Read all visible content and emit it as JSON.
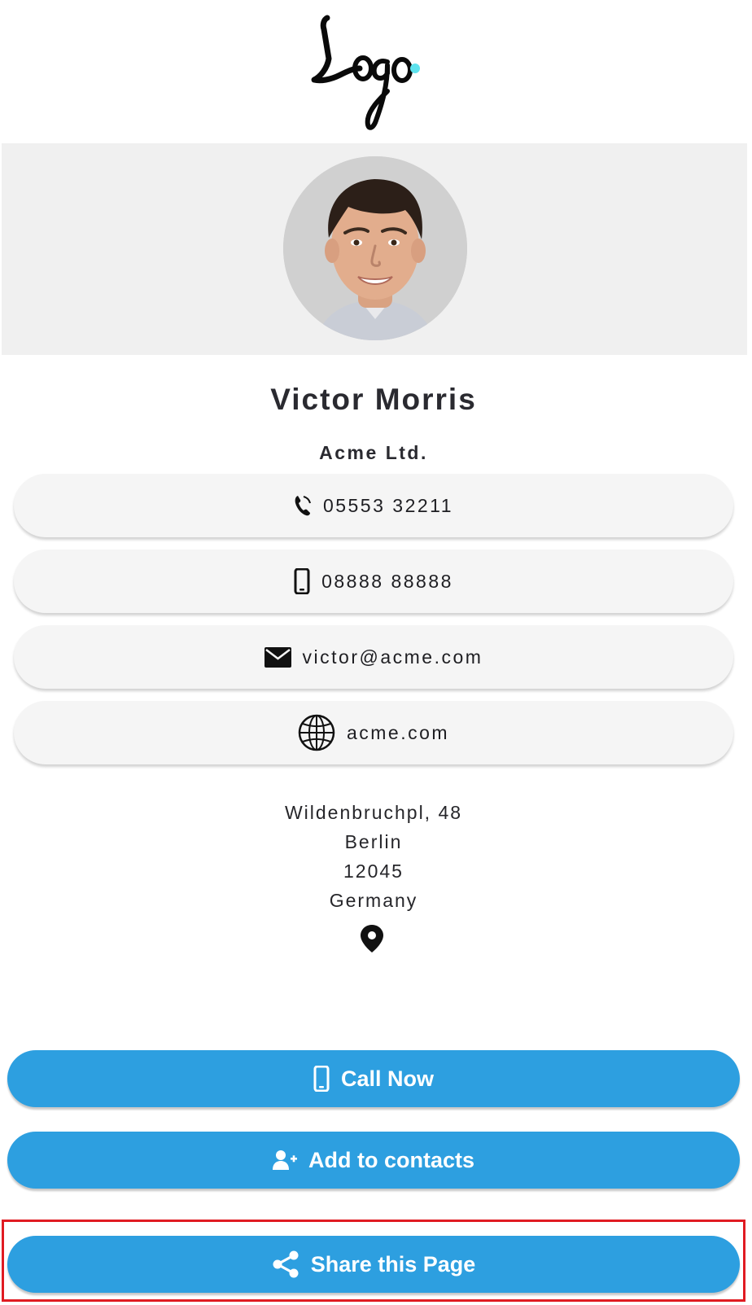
{
  "header": {
    "logo_text": "Logo",
    "logo_accent": "#5ee3ee",
    "logo_icon": "logo-wordmark"
  },
  "profile": {
    "name": "Victor Morris",
    "company": "Acme Ltd.",
    "avatar_icon": "profile-photo"
  },
  "contacts": [
    {
      "type": "phone",
      "icon": "phone-icon",
      "value": "05553 32211"
    },
    {
      "type": "mobile",
      "icon": "mobile-icon",
      "value": "08888 88888"
    },
    {
      "type": "email",
      "icon": "envelope-icon",
      "value": "victor@acme.com"
    },
    {
      "type": "website",
      "icon": "globe-icon",
      "value": "acme.com"
    }
  ],
  "address": {
    "street": "Wildenbruchpl, 48",
    "city": "Berlin",
    "zip": "12045",
    "country": "Germany",
    "icon": "map-pin-icon"
  },
  "actions": {
    "call_now": {
      "label": "Call Now",
      "icon": "mobile-icon"
    },
    "add_contacts": {
      "label": "Add to contacts",
      "icon": "user-plus-icon"
    },
    "share_page": {
      "label": "Share this Page",
      "icon": "share-icon"
    }
  },
  "colors": {
    "button_bg": "#2d9fe0",
    "pill_bg": "#f5f5f5",
    "hero_bg": "#f0f0f0",
    "highlight": "#e01b22"
  }
}
